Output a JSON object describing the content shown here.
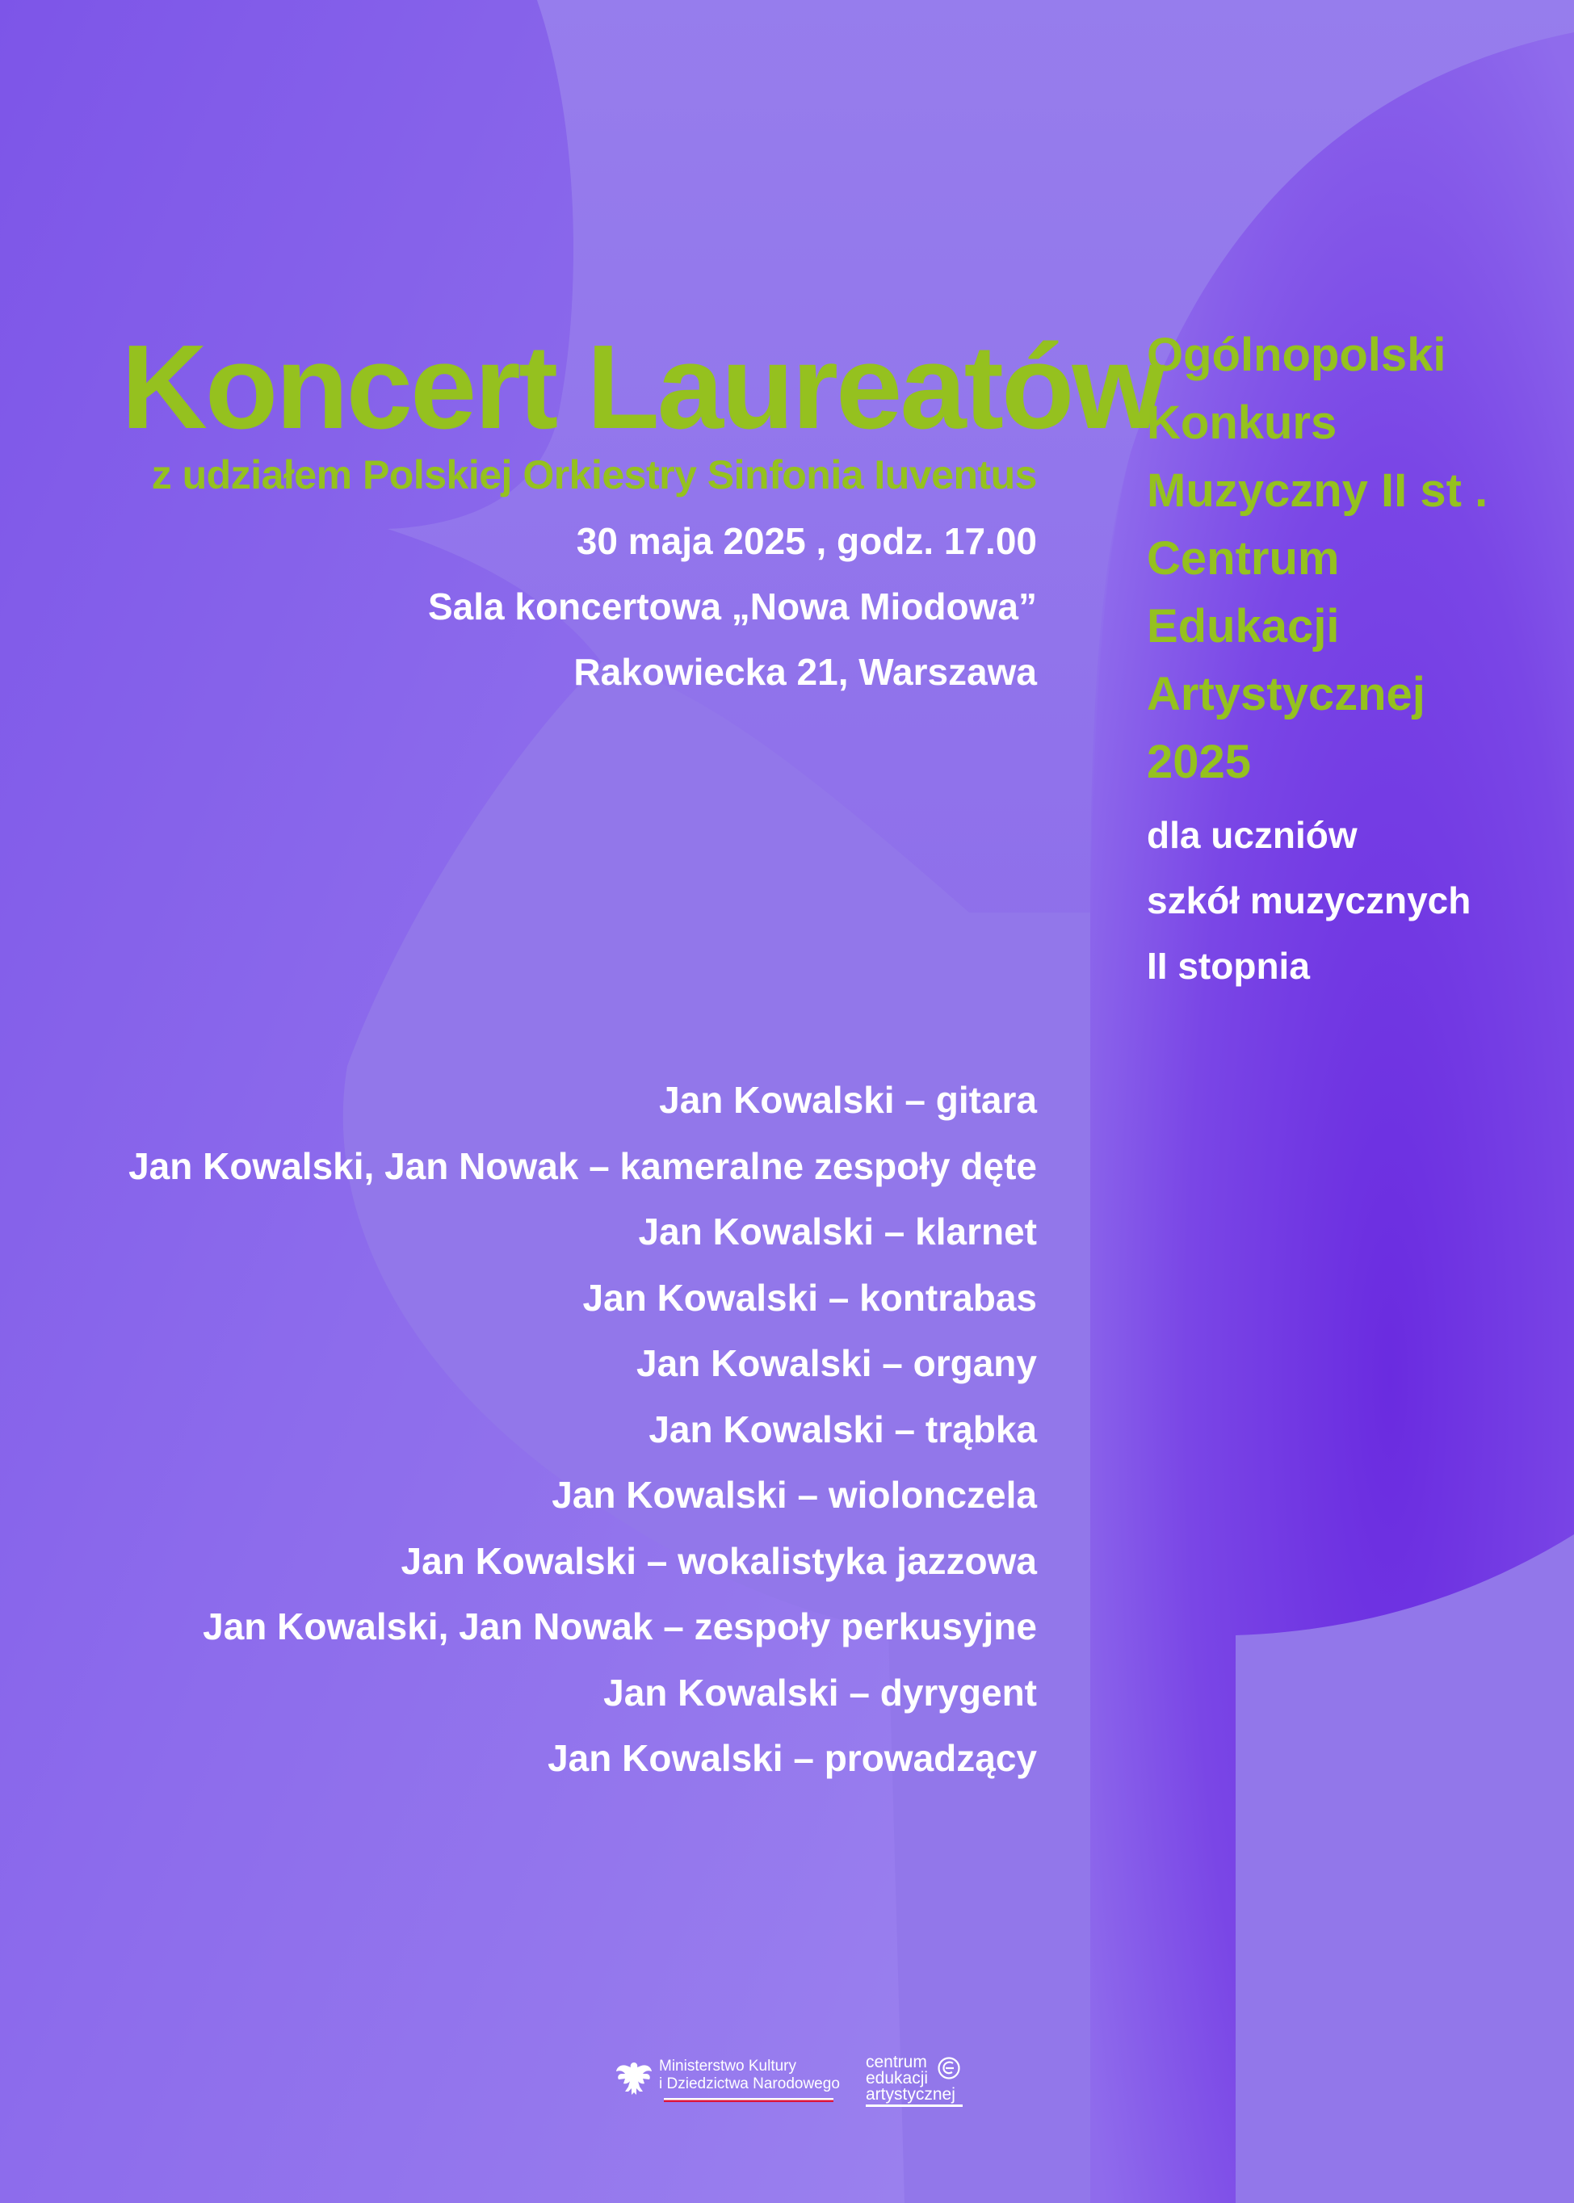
{
  "event": {
    "title": "Koncert Laureatów",
    "subtitle": "z udziałem Polskiej Orkiestry Sinfonia Iuventus",
    "date_time": "30 maja 2025 , godz. 17.00",
    "venue": "Sala koncertowa „Nowa Miodowa”",
    "address": "Rakowiecka 21, Warszawa"
  },
  "competition": {
    "lines": [
      "Ogólnopolski",
      "Konkurs",
      "Muzyczny II st .",
      "Centrum",
      "Edukacji",
      "Artystycznej",
      "2025"
    ],
    "target_lines": [
      "dla uczniów",
      "szkół muzycznych",
      "II stopnia"
    ]
  },
  "performers": [
    "Jan Kowalski – gitara",
    "Jan Kowalski, Jan Nowak – kameralne zespoły dęte",
    "Jan Kowalski – klarnet",
    "Jan Kowalski – kontrabas",
    "Jan Kowalski – organy",
    "Jan Kowalski – trąbka",
    "Jan Kowalski – wiolonczela",
    "Jan Kowalski – wokalistyka jazzowa",
    "Jan Kowalski, Jan Nowak – zespoły perkusyjne",
    "Jan Kowalski – dyrygent",
    "Jan Kowalski – prowadzący"
  ],
  "logos": {
    "ministry": [
      "Ministerstwo Kultury",
      "i Dziedzictwa Narodowego"
    ],
    "cea": [
      "centrum",
      "edukacji",
      "artystycznej"
    ]
  },
  "colors": {
    "background": "#9277ea",
    "accent_green": "#95c11f",
    "shape_dark": "#6b2fe0",
    "text_white": "#ffffff"
  }
}
